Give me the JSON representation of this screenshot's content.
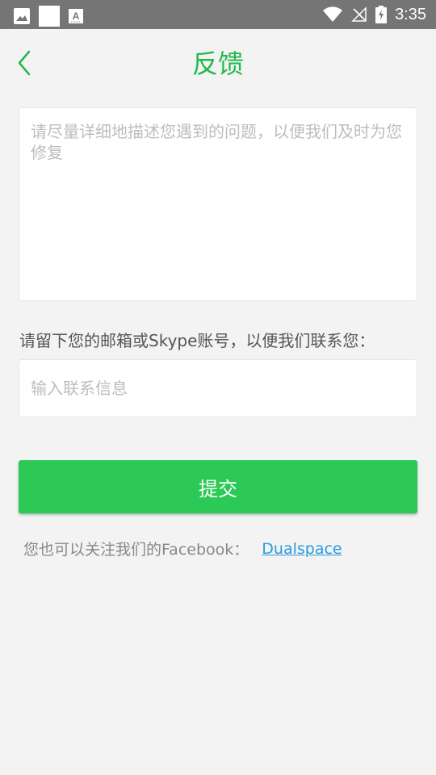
{
  "status_bar": {
    "time": "3:35",
    "icons": [
      "image-icon",
      "blank-square-icon",
      "font-a-icon",
      "wifi-icon",
      "no-signal-icon",
      "battery-charging-icon"
    ]
  },
  "header": {
    "title": "反馈",
    "back_icon": "chevron-left-icon",
    "accent_color": "#22b94b"
  },
  "feedback": {
    "placeholder": "请尽量详细地描述您遇到的问题，以便我们及时为您修复",
    "value": ""
  },
  "contact": {
    "label": "请留下您的邮箱或Skype账号，以便我们联系您：",
    "placeholder": "输入联系信息",
    "value": ""
  },
  "submit": {
    "label": "提交",
    "color": "#2cc956"
  },
  "facebook": {
    "text": "您也可以关注我们的Facebook：",
    "link_text": "Dualspace",
    "link_color": "#2b9be0"
  }
}
